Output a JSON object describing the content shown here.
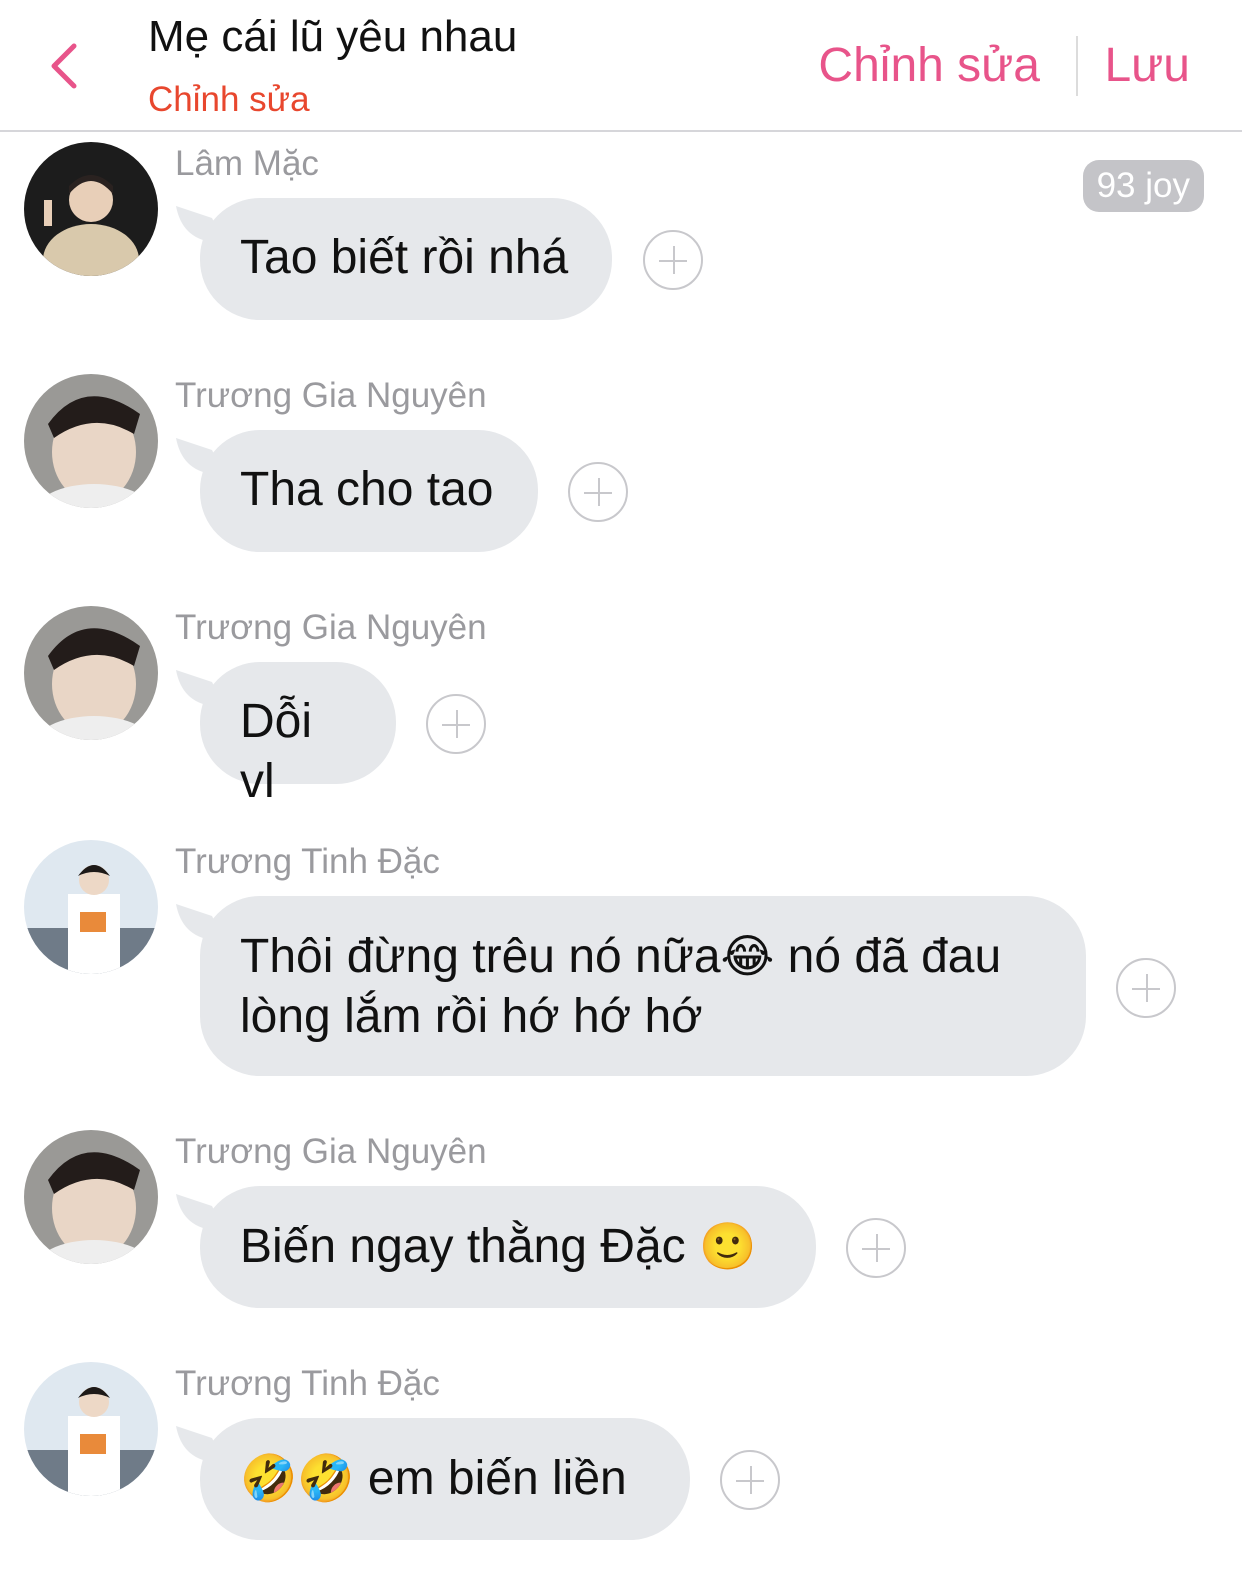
{
  "header": {
    "title": "Mẹ cái lũ yêu nhau",
    "subtitle": "Chỉnh sửa",
    "edit_label": "Chỉnh sửa",
    "save_label": "Lưu",
    "accent_color": "#e8548a",
    "subtitle_color": "#e8472e"
  },
  "badge": {
    "label": "93 joy"
  },
  "messages": [
    {
      "sender": "Lâm Mặc",
      "text": "Tao biết rồi nhá"
    },
    {
      "sender": "Trương Gia Nguyên",
      "text": "Tha cho tao"
    },
    {
      "sender": "Trương Gia Nguyên",
      "text": "Dỗi vl"
    },
    {
      "sender": "Trương Tinh Đặc",
      "text_line1a": "Thôi đừng trêu nó nữa",
      "emoji1": "😂",
      "text_line1b": " nó đã đau",
      "text_line2": "lòng lắm rồi hớ hớ hớ"
    },
    {
      "sender": "Trương Gia Nguyên",
      "text": "Biến ngay thằng Đặc ",
      "emoji": "🙂"
    },
    {
      "sender": "Trương Tinh Đặc",
      "emojis": "🤣🤣",
      "text": " em biến liền"
    }
  ],
  "icons": {
    "back": "chevron-left-icon",
    "add_reaction": "plus-circle-icon"
  }
}
